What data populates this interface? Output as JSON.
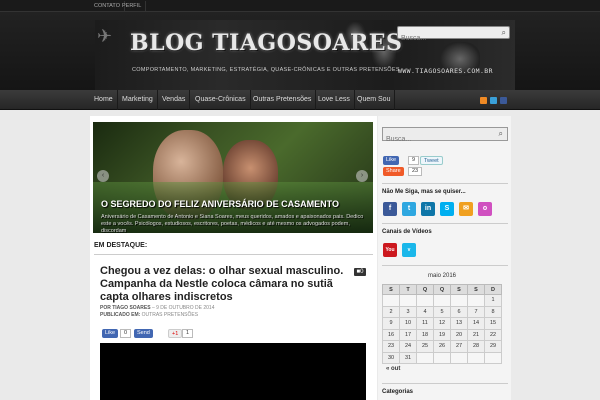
{
  "topbar": {
    "links": [
      "CONTATO",
      "PERFIL"
    ]
  },
  "header": {
    "title": "BLOG TIAGOSOARES",
    "subtitle": "COMPORTAMENTO, MARKETING, ESTRATÉGIA, QUASE-CRÔNICAS E OUTRAS PRETENSÕES",
    "url": "WWW.TIAGOSOARES.COM.BR",
    "search_placeholder": "Busca..."
  },
  "nav": {
    "items": [
      "Home",
      "Marketing",
      "Vendas",
      "Quase-Crônicas",
      "Outras Pretensões",
      "Love Less",
      "Quem Sou"
    ]
  },
  "nav_social_icons": [
    "rss-icon",
    "twitter-icon",
    "facebook-icon"
  ],
  "slider": {
    "title": "O SEGREDO DO FELIZ ANIVERSÁRIO DE CASAMENTO",
    "description": "Aniversário de Casamento de Antonio e Siana Soares, meus queridos, amados e apaixonados pais. Dedico este a vocês. Psicólogos, estudiosos, escritores, poetas, médicos e até mesmo os advogados podem, discordam",
    "prev": "‹",
    "next": "›"
  },
  "featured_label": "EM DESTAQUE:",
  "post": {
    "title": "Chegou a vez delas: o olhar sexual masculino. Campanha da Nestle coloca câmara no sutiã capta olhares indiscretos",
    "comment_icon": "camera-icon",
    "comment_count": "0",
    "by_label": "POR",
    "author": "TIAGO SOARES",
    "date": "– 9 DE OUTUBRO DE 2014",
    "published_label": "PUBLICADO EM:",
    "category": "OUTRAS PRETENSÕES",
    "share": {
      "like": "Like",
      "like_count": "0",
      "send": "Send",
      "gplus": "+1",
      "gplus_count": "1"
    }
  },
  "sidebar": {
    "search_placeholder": "Busca...",
    "share": {
      "like": "Like",
      "like_count": "9",
      "tweet": "Tweet",
      "share": "Share",
      "share_count": "23"
    },
    "follow_title": "Não Me Siga, mas se quiser...",
    "follow_icons": [
      {
        "name": "facebook-icon",
        "glyph": "f",
        "color": "#3b5998"
      },
      {
        "name": "twitter-icon",
        "glyph": "t",
        "color": "#2ea7e0"
      },
      {
        "name": "linkedin-icon",
        "glyph": "in",
        "color": "#0e76a8"
      },
      {
        "name": "skype-icon",
        "glyph": "S",
        "color": "#00aff0"
      },
      {
        "name": "rss-mail-icon",
        "glyph": "✉",
        "color": "#f0a020"
      },
      {
        "name": "orkut-icon",
        "glyph": "o",
        "color": "#d050c0"
      }
    ],
    "video_title": "Canais de Vídeos",
    "video_icons": [
      {
        "name": "youtube-icon",
        "glyph": "You",
        "color": "#cc181e"
      },
      {
        "name": "vimeo-icon",
        "glyph": "v",
        "color": "#1ab7ea"
      }
    ],
    "calendar": {
      "caption": "maio 2016",
      "headers": [
        "S",
        "T",
        "Q",
        "Q",
        "S",
        "S",
        "D"
      ],
      "rows": [
        [
          "",
          "",
          "",
          "",
          "",
          "",
          "1"
        ],
        [
          "2",
          "3",
          "4",
          "5",
          "6",
          "7",
          "8"
        ],
        [
          "9",
          "10",
          "11",
          "12",
          "13",
          "14",
          "15"
        ],
        [
          "16",
          "17",
          "18",
          "19",
          "20",
          "21",
          "22"
        ],
        [
          "23",
          "24",
          "25",
          "26",
          "27",
          "28",
          "29"
        ],
        [
          "30",
          "31",
          "",
          "",
          "",
          "",
          ""
        ]
      ],
      "prev": "« out"
    },
    "categories_title": "Categorias"
  },
  "colors": {
    "accent": "#333333",
    "background": "#eaeaea",
    "header": "#1c1c1c"
  }
}
